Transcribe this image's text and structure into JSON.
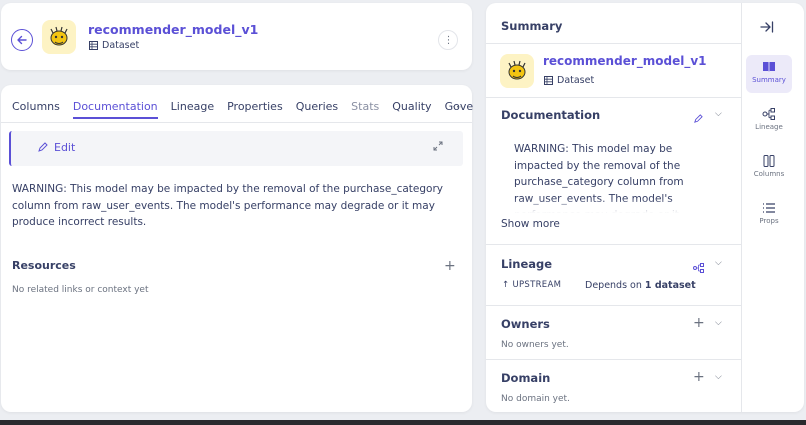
{
  "header": {
    "title": "recommender_model_v1",
    "entity_type": "Dataset"
  },
  "tabs": [
    {
      "label": "Columns",
      "state": "normal"
    },
    {
      "label": "Documentation",
      "state": "active"
    },
    {
      "label": "Lineage",
      "state": "normal"
    },
    {
      "label": "Properties",
      "state": "normal"
    },
    {
      "label": "Queries",
      "state": "normal"
    },
    {
      "label": "Stats",
      "state": "muted"
    },
    {
      "label": "Quality",
      "state": "normal"
    },
    {
      "label": "Gove",
      "state": "normal"
    }
  ],
  "tabs_more": "⋯",
  "documentation": {
    "edit_label": "Edit",
    "text": "WARNING: This model may be impacted by the removal of the purchase_category column from raw_user_events. The model's performance may degrade or it may produce incorrect results."
  },
  "resources": {
    "title": "Resources",
    "empty": "No related links or context yet"
  },
  "summary": {
    "panel_title": "Summary",
    "title": "recommender_model_v1",
    "entity_type": "Dataset",
    "documentation_title": "Documentation",
    "documentation_text": "WARNING: This model may be impacted by the removal of the purchase_category column from raw_user_events. The model's performance may degrade or it may produce incorrect results.",
    "show_more": "Show more",
    "lineage_title": "Lineage",
    "upstream_label": "UPSTREAM",
    "depends_prefix": "Depends on ",
    "depends_count": "1 dataset",
    "owners_title": "Owners",
    "owners_empty": "No owners yet.",
    "domain_title": "Domain",
    "domain_empty": "No domain yet."
  },
  "side_nav": {
    "summary": "Summary",
    "lineage": "Lineage",
    "columns": "Columns",
    "props": "Props"
  },
  "colors": {
    "accent": "#5b50d6",
    "text": "#374066",
    "background": "#eceef2"
  }
}
